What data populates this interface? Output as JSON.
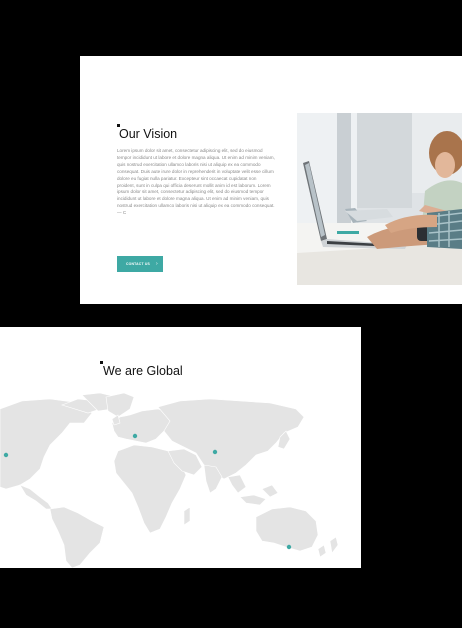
{
  "vision": {
    "title": "Our Vision",
    "body": "Lorem ipsum dolor sit amet, consectetur adipiscing elit, sed do eiusmod tempor incididunt ut labore et dolore magna aliqua. Ut enim ad minim veniam, quis nostrud exercitation ullamco laboris nisi ut aliquip ex ea commodo consequat. Duis aute irure dolor in reprehenderit in voluptate velit esse cillum dolore eu fugiat nulla pariatur. Excepteur sint occaecat cupidatat non proident, sunt in culpa qui officia deserunt mollit anim id est laborum. Lorem ipsum dolor sit amet, consectetur adipiscing elit, sed do eiusmod tempor incididunt ut labore et dolore magna aliqua. Ut enim ad minim veniam, quis nostrud exercitation ullamco laboris nisi ut aliquip ex ea commodo consequat. — C",
    "button_label": "CONTACT US",
    "button_icon": "chevron-right-icon"
  },
  "global": {
    "title": "We are Global"
  },
  "colors": {
    "accent": "#3ea9a4",
    "map_land": "#e4e4e4",
    "heading": "#111111",
    "body_text": "#8a8a8a"
  }
}
